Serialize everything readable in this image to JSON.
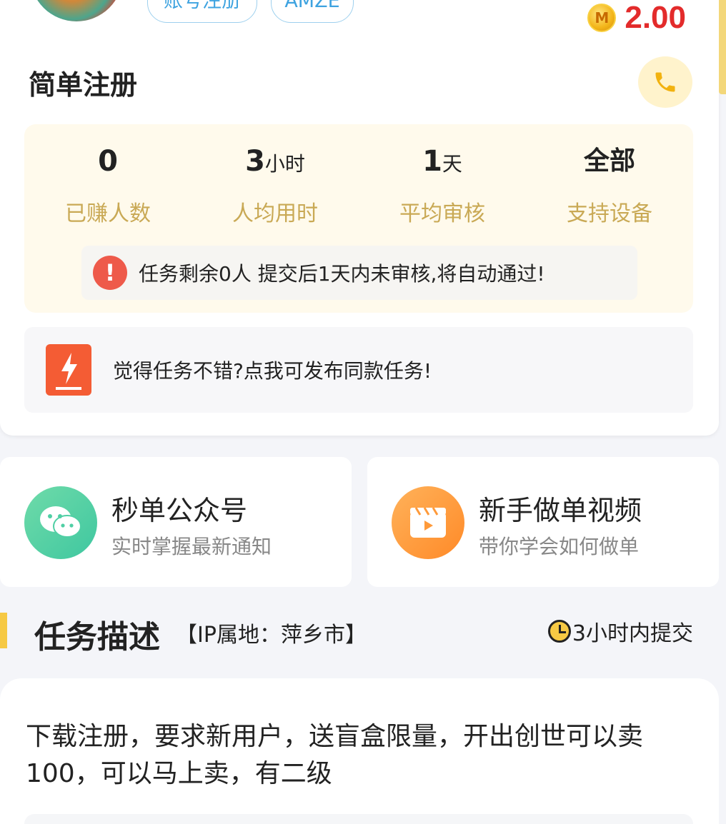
{
  "header": {
    "tags": [
      "账号注册",
      "AMZE"
    ],
    "reward": "2.00",
    "coin_letter": "M",
    "task_title": "简单注册"
  },
  "stats": [
    {
      "value": "0",
      "unit": "",
      "label": "已赚人数"
    },
    {
      "value": "3",
      "unit": "小时",
      "label": "人均用时"
    },
    {
      "value": "1",
      "unit": "天",
      "label": "平均审核"
    },
    {
      "value": "全部",
      "unit": "",
      "label": "支持设备"
    }
  ],
  "notice": {
    "icon": "!",
    "text": "任务剩余0人  提交后1天内未审核,将自动通过!"
  },
  "publish": {
    "text": "觉得任务不错?点我可发布同款任务!"
  },
  "features": [
    {
      "title": "秒单公众号",
      "subtitle": "实时掌握最新通知",
      "icon": "wechat-icon"
    },
    {
      "title": "新手做单视频",
      "subtitle": "带你学会如何做单",
      "icon": "video-icon"
    }
  ],
  "description": {
    "title": "任务描述",
    "ip": "【IP属地：萍乡市】",
    "deadline": "3小时内提交",
    "text": "下载注册，要求新用户，送盲盒限量，开出创世可以卖100，可以马上卖，有二级"
  },
  "colors": {
    "accent": "#f6c944",
    "reward": "#e32b2b",
    "stat_label": "#c9a955",
    "tag": "#3ea3e0"
  }
}
